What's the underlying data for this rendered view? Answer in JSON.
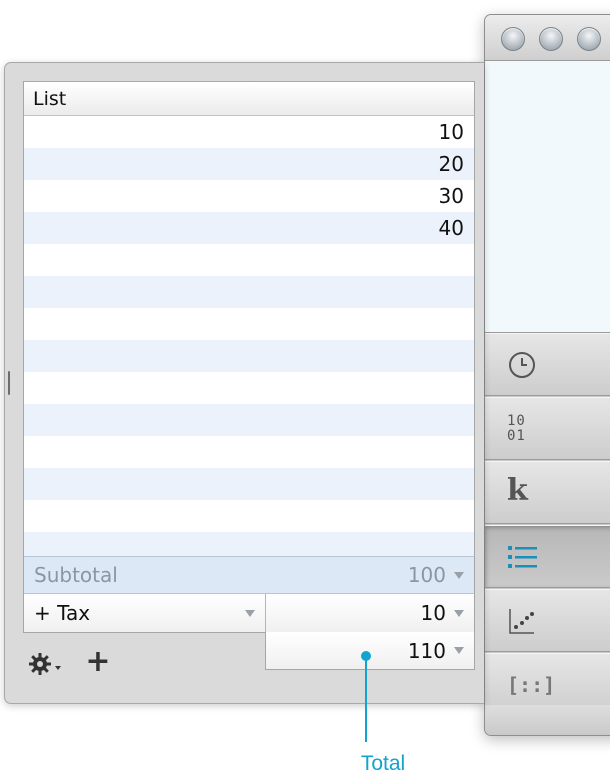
{
  "list": {
    "header": "List",
    "values": [
      "10",
      "20",
      "30",
      "40"
    ]
  },
  "subtotal": {
    "label": "Subtotal",
    "value": "100"
  },
  "tax": {
    "label": "+ Tax",
    "value": "10"
  },
  "total": {
    "value": "110"
  },
  "toolbar": {
    "add_label": "+"
  },
  "callout": {
    "label": "Total"
  },
  "sidebar": {
    "buttons": [
      "clock-icon",
      "binary-icon",
      "constants-icon",
      "list-icon",
      "scatter-plot-icon",
      "matrix-icon"
    ],
    "binary_text": "10\n01",
    "k_text": "k",
    "matrix_text": "[::]"
  },
  "colors": {
    "accent": "#12a3cf",
    "subtotal_bg": "#dce8f6",
    "row_alt": "#ecf2fb"
  }
}
